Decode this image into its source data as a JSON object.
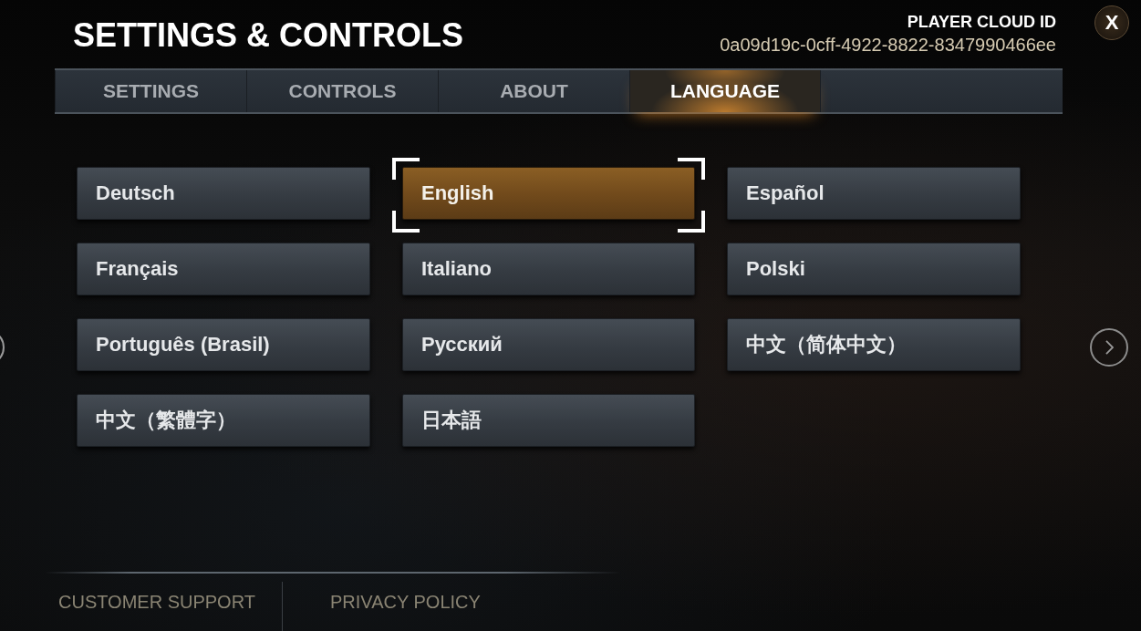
{
  "header": {
    "title": "SETTINGS & CONTROLS",
    "cloud_id_label": "PLAYER CLOUD ID",
    "cloud_id": "0a09d19c-0cff-4922-8822-8347990466ee",
    "close_label": "X"
  },
  "tabs": [
    {
      "label": "SETTINGS",
      "selected": false
    },
    {
      "label": "CONTROLS",
      "selected": false
    },
    {
      "label": "ABOUT",
      "selected": false
    },
    {
      "label": "LANGUAGE",
      "selected": true
    }
  ],
  "languages": [
    {
      "label": "Deutsch",
      "selected": false
    },
    {
      "label": "English",
      "selected": true
    },
    {
      "label": "Español",
      "selected": false
    },
    {
      "label": "Français",
      "selected": false
    },
    {
      "label": "Italiano",
      "selected": false
    },
    {
      "label": "Polski",
      "selected": false
    },
    {
      "label": "Português (Brasil)",
      "selected": false
    },
    {
      "label": "Русский",
      "selected": false
    },
    {
      "label": "中文（简体中文）",
      "selected": false
    },
    {
      "label": "中文（繁體字）",
      "selected": false
    },
    {
      "label": "日本語",
      "selected": false
    }
  ],
  "footer_links": [
    "CUSTOMER SUPPORT",
    "PRIVACY POLICY"
  ]
}
